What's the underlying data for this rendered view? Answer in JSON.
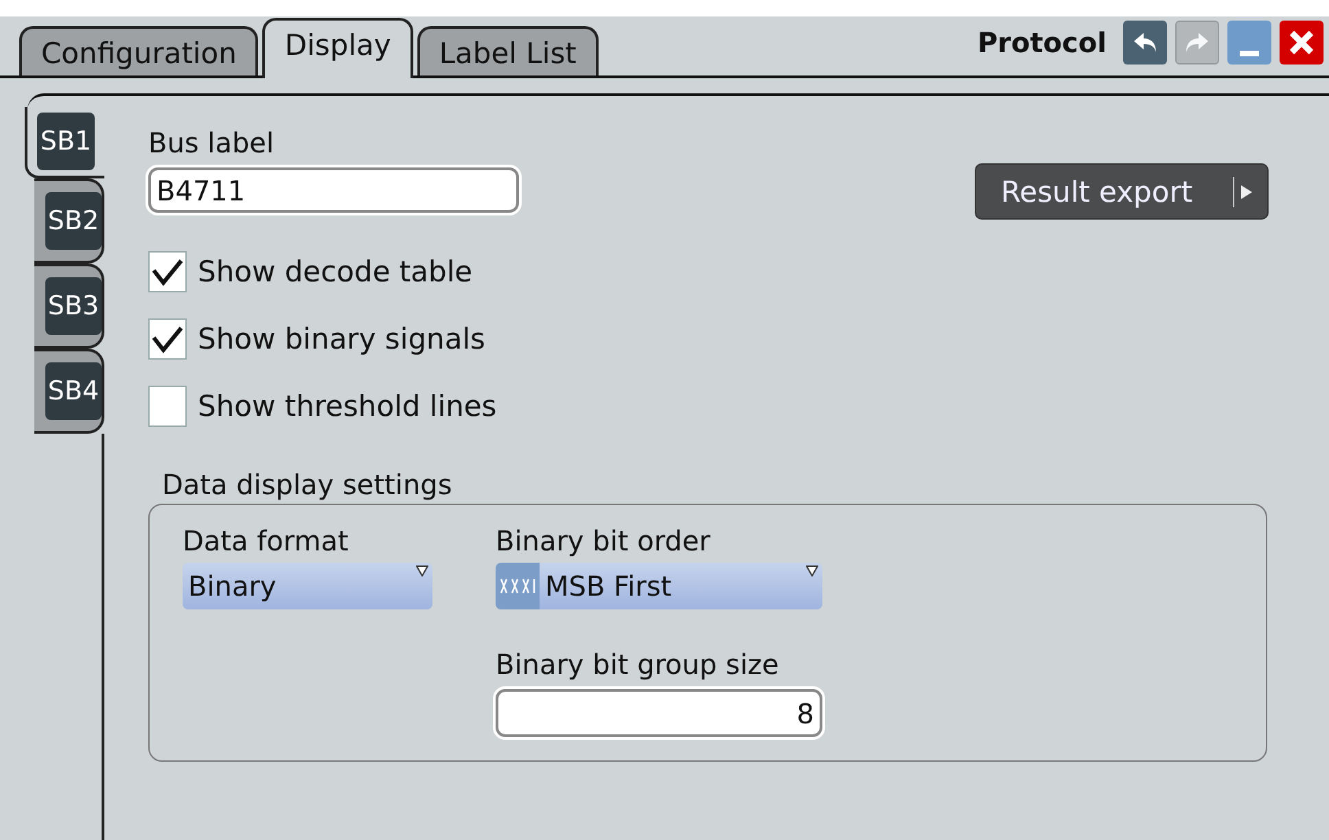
{
  "tabs": [
    {
      "label": "Configuration",
      "selected": false
    },
    {
      "label": "Display",
      "selected": true
    },
    {
      "label": "Label List",
      "selected": false
    }
  ],
  "title": "Protocol",
  "window_buttons": [
    {
      "kind": "undo",
      "disabled": false
    },
    {
      "kind": "redo",
      "disabled": true
    },
    {
      "kind": "minimize",
      "disabled": false
    },
    {
      "kind": "close",
      "disabled": false
    }
  ],
  "side_tabs": [
    {
      "label": "SB1",
      "selected": true
    },
    {
      "label": "SB2",
      "selected": false
    },
    {
      "label": "SB3",
      "selected": false
    },
    {
      "label": "SB4",
      "selected": false
    }
  ],
  "bus_label": {
    "label": "Bus label",
    "value": "B4711"
  },
  "result_export": {
    "label": "Result export"
  },
  "checkboxes": [
    {
      "label": "Show decode table",
      "checked": true
    },
    {
      "label": "Show binary signals",
      "checked": true
    },
    {
      "label": "Show threshold lines",
      "checked": false
    }
  ],
  "data_display_settings": {
    "title": "Data display settings",
    "data_format": {
      "label": "Data format",
      "value": "Binary"
    },
    "binary_bit_order": {
      "label": "Binary bit order",
      "value": "MSB First"
    },
    "binary_bit_group_size": {
      "label": "Binary bit group size",
      "value": "8"
    }
  }
}
